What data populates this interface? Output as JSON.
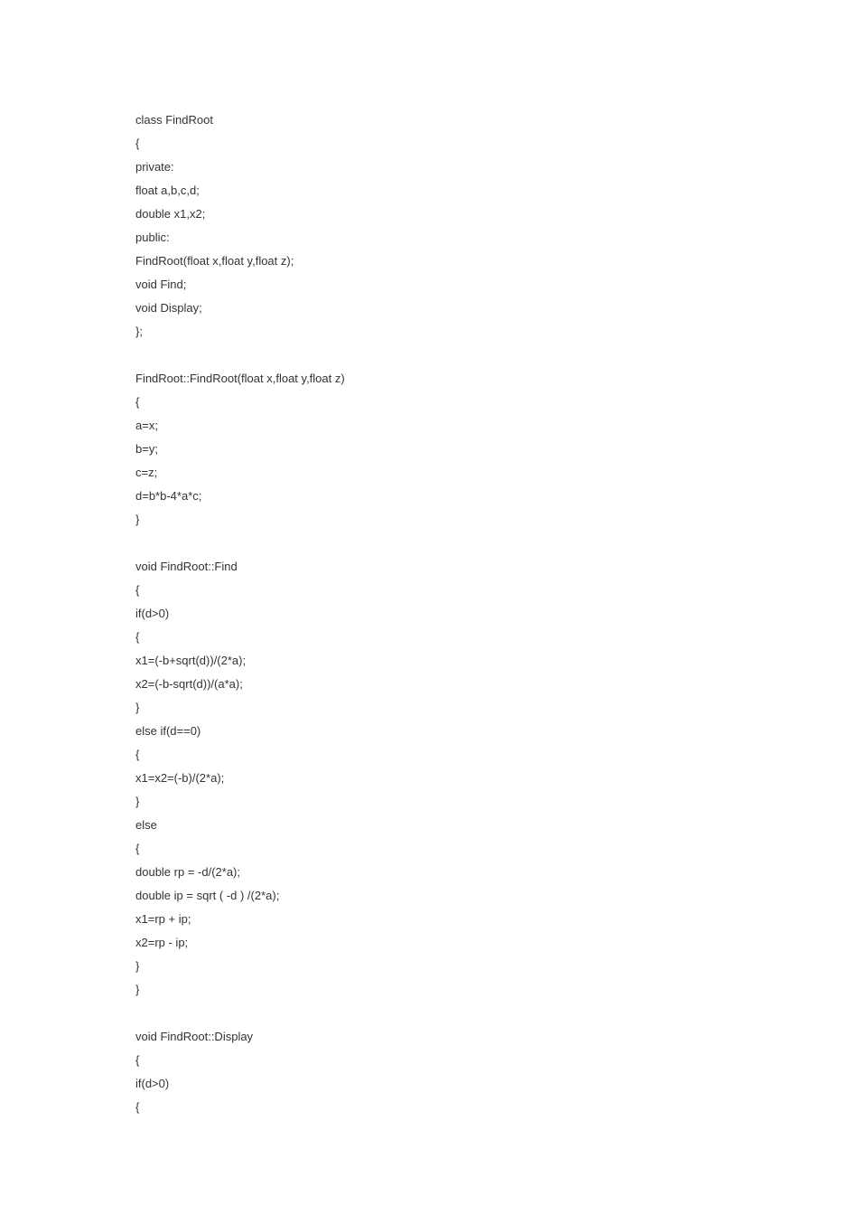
{
  "code": {
    "lines": [
      "class FindRoot",
      "{",
      "private:",
      "float a,b,c,d;",
      "double x1,x2;",
      "public:",
      "FindRoot(float x,float y,float z);",
      "void Find;",
      "void Display;",
      "};",
      "",
      "FindRoot::FindRoot(float x,float y,float z)",
      "{",
      "a=x;",
      "b=y;",
      "c=z;",
      "d=b*b-4*a*c;",
      "}",
      "",
      "void FindRoot::Find",
      "{",
      "if(d>0)",
      "{",
      "x1=(-b+sqrt(d))/(2*a);",
      "x2=(-b-sqrt(d))/(a*a);",
      "}",
      "else if(d==0)",
      "{",
      "x1=x2=(-b)/(2*a);",
      "}",
      "else",
      "{",
      "double rp = -d/(2*a);",
      "double ip = sqrt ( -d ) /(2*a);",
      "x1=rp + ip;",
      "x2=rp - ip;",
      "}",
      "}",
      "",
      "void FindRoot::Display",
      "{",
      "if(d>0)",
      "{"
    ]
  }
}
